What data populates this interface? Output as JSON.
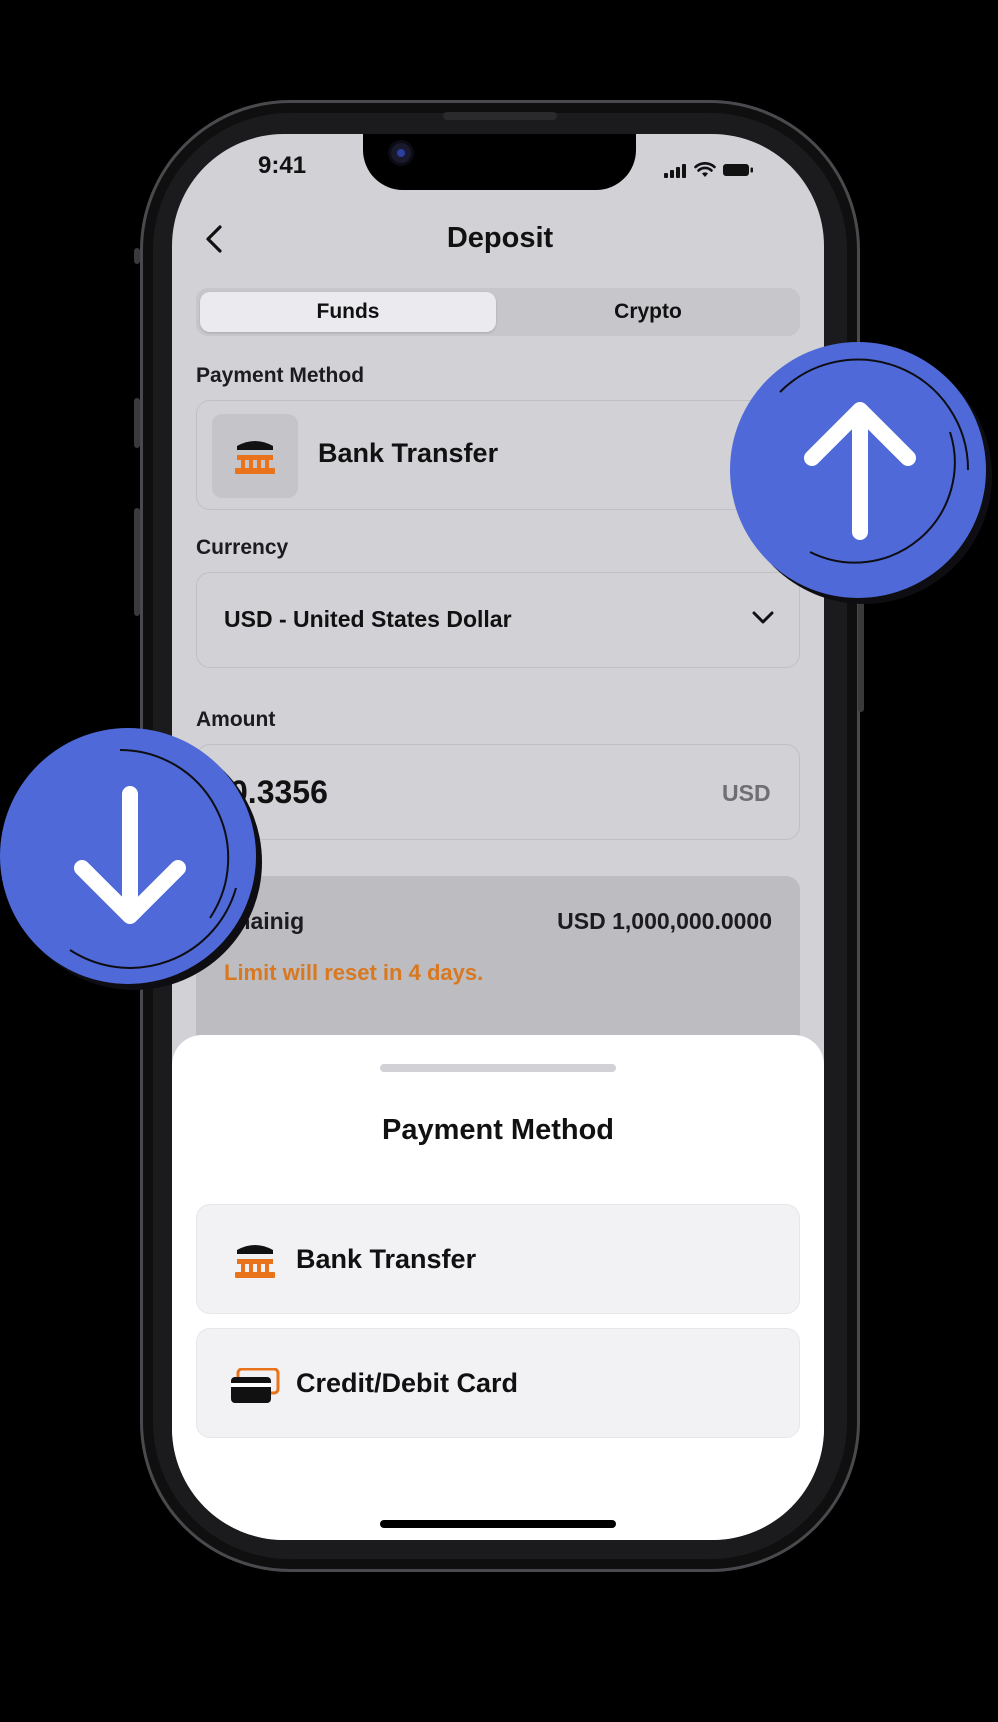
{
  "status_bar": {
    "time": "9:41"
  },
  "header": {
    "title": "Deposit",
    "back_icon": "chevron-left-icon"
  },
  "tabs": [
    {
      "label": "Funds",
      "active": true
    },
    {
      "label": "Crypto",
      "active": false
    }
  ],
  "form": {
    "payment_method_label": "Payment Method",
    "payment_method_value": "Bank Transfer",
    "currency_label": "Currency",
    "currency_value": "USD - United States Dollar",
    "amount_label": "Amount",
    "amount_value": "0.3356",
    "amount_unit": "USD",
    "remaining_label": "mainig",
    "remaining_value": "USD 1,000,000.0000",
    "limit_note": "Limit will reset in 4 days."
  },
  "sheet": {
    "title": "Payment Method",
    "options": [
      {
        "label": "Bank Transfer",
        "icon": "bank-icon"
      },
      {
        "label": "Credit/Debit Card",
        "icon": "credit-card-icon"
      }
    ]
  },
  "colors": {
    "accent_blue": "#4f6ad8",
    "accent_orange": "#e8731a",
    "warning_text": "#d9781f"
  }
}
